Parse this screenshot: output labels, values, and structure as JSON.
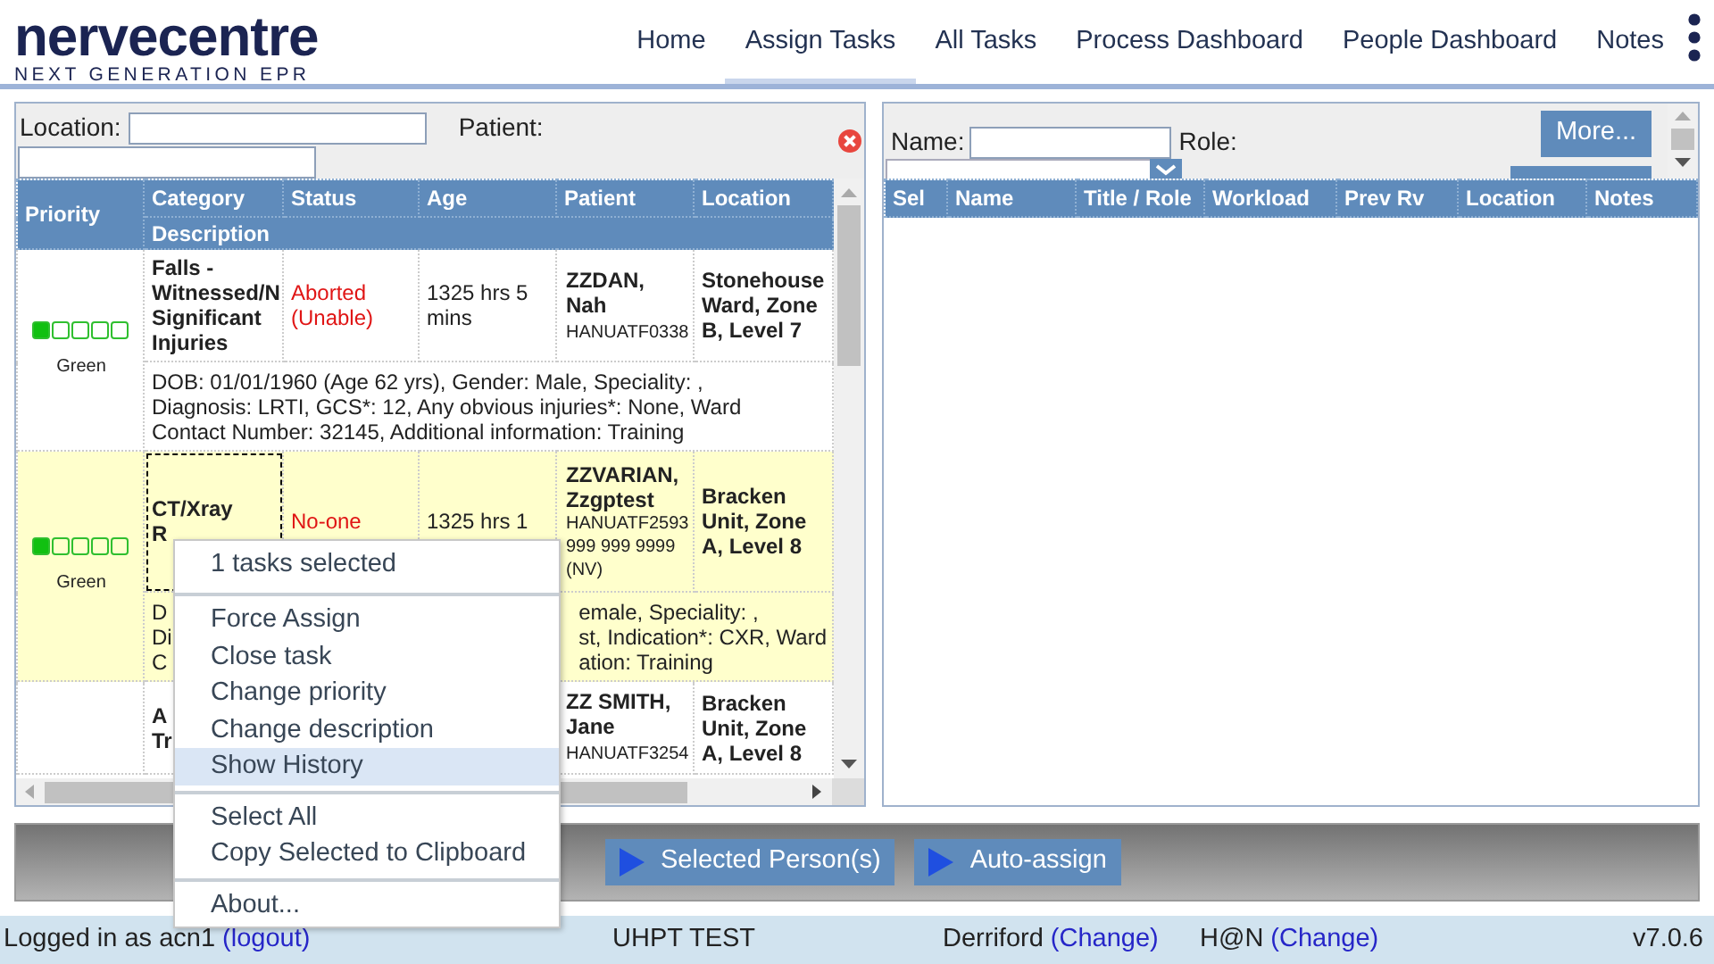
{
  "header": {
    "logo": {
      "wordmark": "nervecentre",
      "tagline": "NEXT GENERATION EPR"
    },
    "nav": [
      {
        "label": "Home",
        "selected": false
      },
      {
        "label": "Assign Tasks",
        "selected": true
      },
      {
        "label": "All Tasks",
        "selected": false
      },
      {
        "label": "Process Dashboard",
        "selected": false
      },
      {
        "label": "People Dashboard",
        "selected": false
      },
      {
        "label": "Notes",
        "selected": false
      }
    ]
  },
  "task_panel": {
    "filters": [
      {
        "label": "Location:"
      },
      {
        "label": "Patient:"
      }
    ],
    "columns": [
      "Priority",
      "Category",
      "Status",
      "Age",
      "Patient",
      "Location"
    ],
    "subheading": "Description",
    "rows": [
      {
        "highlighted": false,
        "focused": false,
        "priority": {
          "level": 0.2,
          "label": "Green"
        },
        "category": [
          "Falls -",
          "Witnessed/N",
          "Significant",
          "Injuries"
        ],
        "status": {
          "text": "Aborted (Unable)",
          "kind": "alert"
        },
        "age": "1325 hrs 5 mins",
        "patient": {
          "name": "ZZDAN, Nah",
          "details": [
            "HANUATF0338"
          ]
        },
        "location": "Stonehouse Ward, Zone B, Level 7",
        "description": [
          [
            "DOB: 01/01/1960 (Age 62 yrs), Gender: Male, Speciality: , Diagnosis: LRTI, GCS*: 12, Any obvious injuries*: None, Ward Contact Number: 32145, Additional information: Training"
          ]
        ]
      },
      {
        "highlighted": true,
        "focused": true,
        "priority": {
          "level": 0.2,
          "label": "Green"
        },
        "category": [
          "CT/Xray",
          "R"
        ],
        "status": {
          "text": "No-one",
          "kind": "alert"
        },
        "age": "1325 hrs 1",
        "patient": {
          "name": "ZZVARIAN, Zzgptest",
          "details": [
            "HANUATF2593",
            "999 999 9999",
            "(NV)"
          ]
        },
        "location": "Bracken Unit, Zone A, Level 8",
        "description": [
          [
            "D",
            "Di",
            "C"
          ],
          [
            "emale, Speciality: ,",
            "st, Indication*: CXR, Ward",
            "ation: Training"
          ]
        ]
      },
      {
        "highlighted": false,
        "focused": false,
        "category": [
          "A",
          "Tr"
        ],
        "patient": {
          "name": "ZZ SMITH, Jane",
          "details": [
            "HANUATF3254"
          ]
        },
        "location": "Bracken Unit, Zone A, Level 8"
      }
    ]
  },
  "people_panel": {
    "filters": [
      {
        "label": "Name:"
      },
      {
        "label": "Role:"
      }
    ],
    "more_button": "More...",
    "columns": [
      "Sel",
      "Name",
      "Title / Role",
      "Workload",
      "Prev Rv",
      "Location",
      "Notes"
    ]
  },
  "context_menu": {
    "title": "1 tasks selected",
    "groups": [
      [
        {
          "label": "Force Assign",
          "selected": false
        },
        {
          "label": "Close task",
          "selected": false
        },
        {
          "label": "Change priority",
          "selected": false
        },
        {
          "label": "Change description",
          "selected": false
        },
        {
          "label": "Show History",
          "selected": true
        }
      ],
      [
        {
          "label": "Select All",
          "selected": false
        },
        {
          "label": "Copy Selected to Clipboard",
          "selected": false
        }
      ],
      [
        {
          "label": "About...",
          "selected": false
        }
      ]
    ]
  },
  "actions": [
    "Selected Person(s)",
    "Auto-assign"
  ],
  "status_bar": [
    {
      "text": "Logged in as acn1",
      "link": "(logout)"
    },
    {
      "text": "UHPT TEST"
    },
    {
      "text": "Derriford",
      "link": "(Change)"
    },
    {
      "text": "H@N",
      "link": "(Change)"
    },
    {
      "text": "v7.0.6"
    }
  ]
}
